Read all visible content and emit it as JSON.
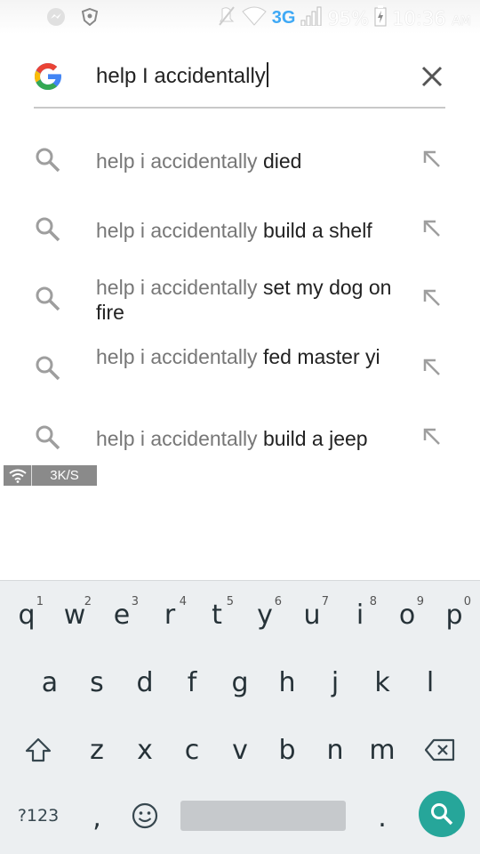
{
  "status_bar": {
    "network": "3G",
    "battery": "95%",
    "time": "10:36",
    "ampm": "AM"
  },
  "search": {
    "query": "help I accidentally"
  },
  "suggestions": [
    {
      "prefix": "help i accidentally",
      "completion": " died"
    },
    {
      "prefix": "help i accidentally",
      "completion": " build a shelf"
    },
    {
      "prefix": "help i accidentally",
      "completion": " set my dog on fire"
    },
    {
      "prefix": "help i accidentally",
      "completion": " fed master yi"
    },
    {
      "prefix": "help i accidentally",
      "completion": " build a jeep"
    }
  ],
  "speed_indicator": {
    "value": "3K/S"
  },
  "keyboard": {
    "row1": [
      {
        "key": "q",
        "hint": "1"
      },
      {
        "key": "w",
        "hint": "2"
      },
      {
        "key": "e",
        "hint": "3"
      },
      {
        "key": "r",
        "hint": "4"
      },
      {
        "key": "t",
        "hint": "5"
      },
      {
        "key": "y",
        "hint": "6"
      },
      {
        "key": "u",
        "hint": "7"
      },
      {
        "key": "i",
        "hint": "8"
      },
      {
        "key": "o",
        "hint": "9"
      },
      {
        "key": "p",
        "hint": "0"
      }
    ],
    "row2": [
      "a",
      "s",
      "d",
      "f",
      "g",
      "h",
      "j",
      "k",
      "l"
    ],
    "row3": [
      "z",
      "x",
      "c",
      "v",
      "b",
      "n",
      "m"
    ],
    "symbols_label": "?123",
    "comma": ",",
    "period": "."
  },
  "colors": {
    "accent": "#26a69a",
    "network": "#3fa9f5",
    "keyboard_bg": "#eceff1"
  }
}
